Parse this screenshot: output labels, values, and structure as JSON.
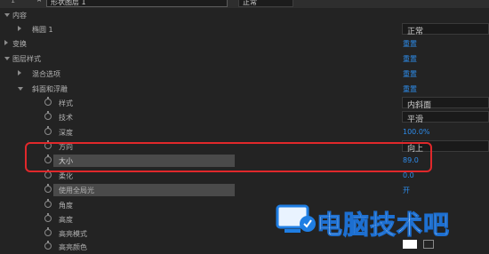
{
  "layer_header": {
    "number": "1",
    "name": "形状图层 1",
    "mode": "正常"
  },
  "rows": {
    "content": "内容",
    "ellipse": "椭圆 1",
    "ellipse_mode": "正常",
    "transform": "变换",
    "transform_reset": "重置",
    "layer_styles": "图层样式",
    "layer_styles_reset": "重置",
    "blending": "混合选项",
    "blending_reset": "重置",
    "bevel": "斜面和浮雕",
    "bevel_reset": "重置",
    "style_label": "样式",
    "style_value": "内斜面",
    "technique_label": "技术",
    "technique_value": "平滑",
    "depth_label": "深度",
    "depth_value": "100.0%",
    "direction_label": "方向",
    "direction_value": "向上",
    "size_label": "大小",
    "size_value": "89.0",
    "soften_label": "柔化",
    "soften_value": "0.0",
    "global_light_label": "使用全局光",
    "global_light_value": "开",
    "angle_label": "角度",
    "altitude_label": "高度",
    "highlight_mode_label": "高亮模式",
    "highlight_color_label": "高亮颜色"
  },
  "watermark": "电脑技术吧",
  "colors": {
    "background": "#232323",
    "link_blue": "#2d8ceb",
    "highlight_box": "#e0282b",
    "selected_row": "#4a4a4a"
  }
}
